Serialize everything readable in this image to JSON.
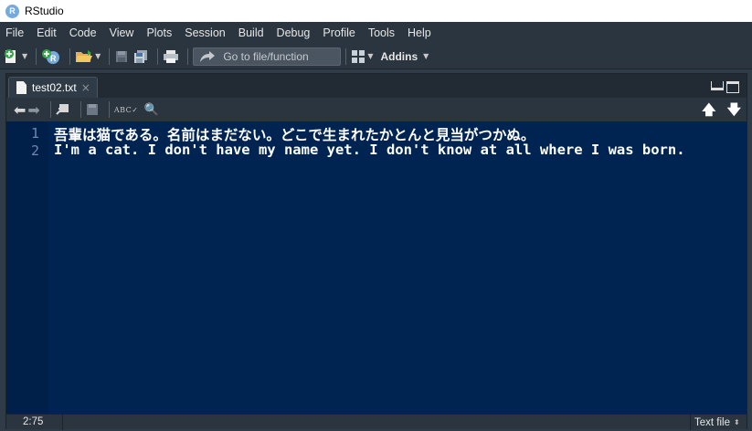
{
  "window": {
    "title": "RStudio",
    "app_icon_letter": "R"
  },
  "menu": [
    "File",
    "Edit",
    "Code",
    "View",
    "Plots",
    "Session",
    "Build",
    "Debug",
    "Profile",
    "Tools",
    "Help"
  ],
  "toolbar": {
    "goto_placeholder": "Go to file/function",
    "addins_label": "Addins"
  },
  "tab": {
    "label": "test02.txt",
    "close": "×"
  },
  "editor": {
    "lines": [
      {
        "number": "1",
        "text": "吾輩は猫である。名前はまだない。どこで生まれたかとんと見当がつかぬ。"
      },
      {
        "number": "2",
        "text": "I'm a cat. I don't have my name yet. I don't know at all where I was born."
      }
    ]
  },
  "status": {
    "cursor_position": "2:75",
    "file_type": "Text file"
  },
  "colors": {
    "editor_bg": "#002451",
    "gutter_fg": "#7285b7",
    "chrome": "#2b3540"
  }
}
